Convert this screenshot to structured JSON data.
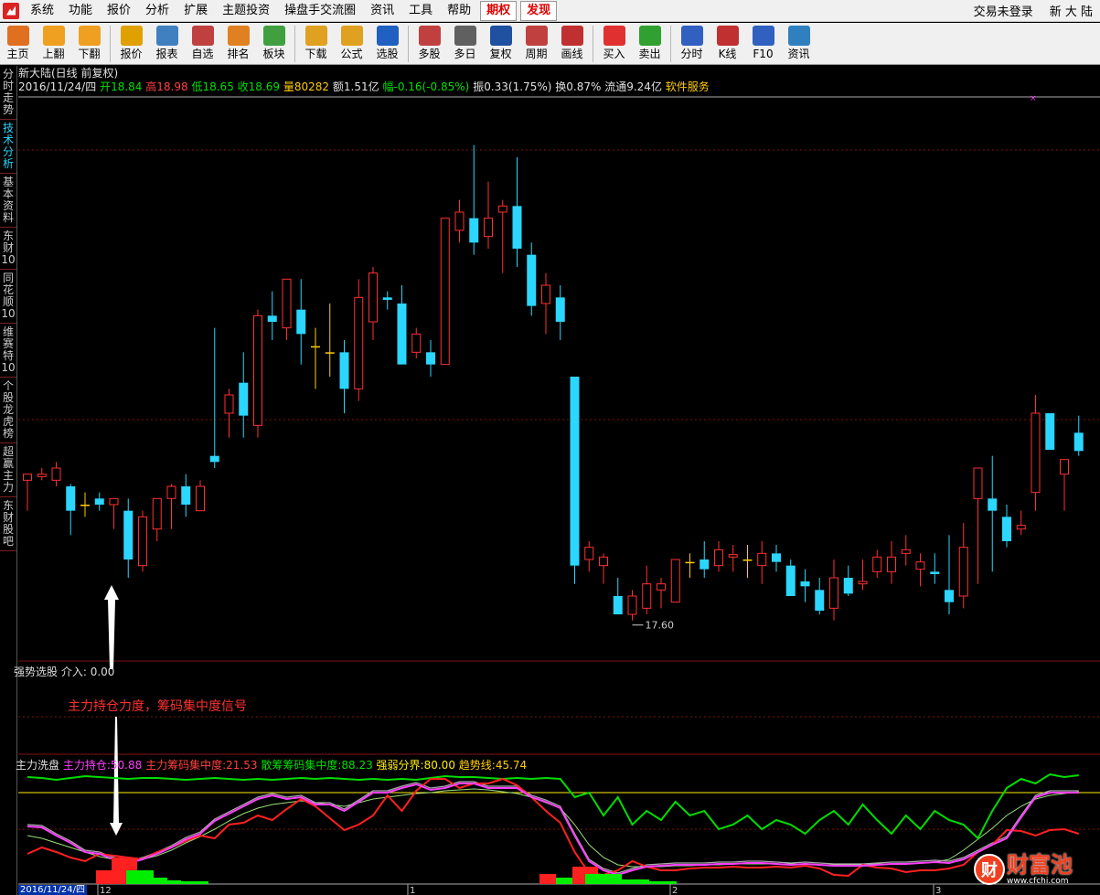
{
  "menu": {
    "items": [
      "系统",
      "功能",
      "报价",
      "分析",
      "扩展",
      "主题投资",
      "操盘手交流圈",
      "资讯",
      "工具",
      "帮助"
    ],
    "highlight": [
      "期权",
      "发现"
    ],
    "login_status": "交易未登录",
    "stock_name": "新 大 陆"
  },
  "toolbar": [
    {
      "icon": "home-icon",
      "label": "主页",
      "color": "#e07020"
    },
    {
      "icon": "up-arrow-icon",
      "label": "上翻",
      "color": "#f0a020"
    },
    {
      "icon": "down-arrow-icon",
      "label": "下翻",
      "color": "#f0a020"
    },
    {
      "icon": "yen-icon",
      "label": "报价",
      "color": "#e0a000"
    },
    {
      "icon": "table-icon",
      "label": "报表",
      "color": "#4080c0"
    },
    {
      "icon": "f6-icon",
      "label": "自选",
      "color": "#c04040"
    },
    {
      "icon": "ranking-icon",
      "label": "排名",
      "color": "#e08020"
    },
    {
      "icon": "blocks-icon",
      "label": "板块",
      "color": "#40a040"
    },
    {
      "icon": "download-icon",
      "label": "下载",
      "color": "#e0a020"
    },
    {
      "icon": "formula-icon",
      "label": "公式",
      "color": "#e0a020"
    },
    {
      "icon": "stock-select-icon",
      "label": "选股",
      "color": "#2060c0"
    },
    {
      "icon": "multi-stock-icon",
      "label": "多股",
      "color": "#c04040"
    },
    {
      "icon": "multi-day-icon",
      "label": "多日",
      "color": "#606060"
    },
    {
      "icon": "restore-right-icon",
      "label": "复权",
      "color": "#2050a0"
    },
    {
      "icon": "f8-icon",
      "label": "周期",
      "color": "#c04040"
    },
    {
      "icon": "draw-line-icon",
      "label": "画线",
      "color": "#c03030"
    },
    {
      "icon": "buy-icon",
      "label": "买入",
      "color": "#e03030"
    },
    {
      "icon": "sell-icon",
      "label": "卖出",
      "color": "#30a030"
    },
    {
      "icon": "intraday-icon",
      "label": "分时",
      "color": "#3060c0"
    },
    {
      "icon": "kline-icon",
      "label": "K线",
      "color": "#c03030"
    },
    {
      "icon": "f10-icon",
      "label": "F10",
      "color": "#3060c0"
    },
    {
      "icon": "news-icon",
      "label": "资讯",
      "color": "#3080c0"
    }
  ],
  "sidebar": [
    "分时走势",
    "技术分析",
    "基本资料",
    "东财10",
    "同花顺10",
    "维赛特10",
    "个股龙虎榜",
    "超赢主力",
    "东财股吧"
  ],
  "sidebar_active": 1,
  "header": {
    "title": "新大陆(日线 前复权)",
    "date": "2016/11/24/四",
    "open_label": "开",
    "open": "18.84",
    "high_label": "高",
    "high": "18.98",
    "low_label": "低",
    "low": "18.65",
    "close_label": "收",
    "close": "18.69",
    "volume_label": "量",
    "volume": "80282",
    "amount_label": "额",
    "amount": "1.51亿",
    "change_label": "幅",
    "change": "-0.16(-0.85%)",
    "amplitude_label": "振",
    "amplitude": "0.33(1.75%)",
    "turnover_label": "换",
    "turnover": "0.87%",
    "float_label": "流通",
    "float": "9.24亿",
    "software_service": "软件服务"
  },
  "price_low_label": "17.60",
  "panel2": {
    "title": "强势选股",
    "value_label": "介入:",
    "value": "0.00"
  },
  "annotation": "主力持仓力度，筹码集中度信号",
  "panel3": {
    "title": "主力洗盘",
    "items": [
      {
        "label": "主力持仓:",
        "value": "50.88",
        "color": "#ff40ff"
      },
      {
        "label": "主力筹码集中度:",
        "value": "21.53",
        "color": "#ff3030"
      },
      {
        "label": "散筹筹码集中度:",
        "value": "88.23",
        "color": "#00dd00"
      },
      {
        "label": "强弱分界:",
        "value": "80.00",
        "color": "#ffee00"
      },
      {
        "label": "趋势线:",
        "value": "45.74",
        "color": "#ffcc00"
      }
    ]
  },
  "axis": {
    "date_box": "2016/11/24/四",
    "ticks": [
      "12",
      "1",
      "2",
      "3"
    ]
  },
  "watermark": {
    "brand": "财富池",
    "url": "www.cfchi.com",
    "glyph": "财"
  },
  "colors": {
    "up": "#ff3030",
    "down": "#2bd6ff",
    "doji": "#ffcc00",
    "grid": "#801010"
  },
  "chart_data": {
    "type": "candlestick",
    "candles": [
      [
        18.45,
        18.5,
        18.2,
        18.5
      ],
      [
        18.48,
        18.55,
        18.45,
        18.5
      ],
      [
        18.45,
        18.6,
        18.4,
        18.55
      ],
      [
        18.4,
        18.42,
        18.0,
        18.2
      ],
      [
        18.25,
        18.35,
        18.15,
        18.25
      ],
      [
        18.3,
        18.35,
        18.2,
        18.25
      ],
      [
        18.25,
        18.3,
        18.05,
        18.3
      ],
      [
        18.2,
        18.3,
        17.65,
        17.8
      ],
      [
        17.75,
        18.2,
        17.7,
        18.15
      ],
      [
        18.05,
        18.3,
        17.95,
        18.3
      ],
      [
        18.3,
        18.42,
        18.05,
        18.4
      ],
      [
        18.4,
        18.5,
        18.15,
        18.25
      ],
      [
        18.2,
        18.45,
        18.2,
        18.4
      ],
      [
        18.65,
        19.7,
        18.55,
        18.6
      ],
      [
        19.0,
        19.2,
        18.8,
        19.15
      ],
      [
        19.25,
        19.5,
        18.8,
        18.98
      ],
      [
        18.9,
        19.85,
        18.8,
        19.8
      ],
      [
        19.8,
        20.0,
        19.6,
        19.75
      ],
      [
        19.7,
        20.1,
        19.6,
        20.1
      ],
      [
        19.85,
        20.1,
        19.4,
        19.65
      ],
      [
        19.55,
        19.7,
        19.2,
        19.55
      ],
      [
        19.5,
        19.9,
        19.3,
        19.5
      ],
      [
        19.5,
        19.6,
        19.0,
        19.2
      ],
      [
        19.2,
        20.1,
        19.1,
        19.95
      ],
      [
        19.75,
        20.2,
        19.6,
        20.15
      ],
      [
        19.95,
        20.0,
        19.85,
        19.93
      ],
      [
        19.9,
        20.05,
        19.4,
        19.4
      ],
      [
        19.5,
        19.7,
        19.45,
        19.65
      ],
      [
        19.5,
        19.6,
        19.3,
        19.4
      ],
      [
        19.4,
        20.6,
        19.4,
        20.6
      ],
      [
        20.5,
        20.75,
        20.4,
        20.65
      ],
      [
        20.6,
        21.2,
        20.3,
        20.4
      ],
      [
        20.45,
        20.9,
        20.35,
        20.6
      ],
      [
        20.65,
        20.75,
        20.15,
        20.7
      ],
      [
        20.7,
        21.1,
        20.2,
        20.35
      ],
      [
        20.3,
        20.4,
        19.8,
        19.88
      ],
      [
        19.9,
        20.15,
        19.65,
        20.05
      ],
      [
        19.95,
        20.05,
        19.6,
        19.75
      ],
      [
        19.3,
        19.3,
        17.6,
        17.75
      ],
      [
        17.8,
        17.95,
        17.7,
        17.9
      ],
      [
        17.75,
        17.85,
        17.6,
        17.82
      ],
      [
        17.5,
        17.65,
        17.35,
        17.35
      ],
      [
        17.35,
        17.55,
        17.3,
        17.5
      ],
      [
        17.4,
        17.75,
        17.35,
        17.6
      ],
      [
        17.55,
        17.65,
        17.4,
        17.6
      ],
      [
        17.45,
        17.8,
        17.45,
        17.8
      ],
      [
        17.78,
        17.85,
        17.65,
        17.78
      ],
      [
        17.8,
        17.95,
        17.65,
        17.72
      ],
      [
        17.75,
        17.95,
        17.7,
        17.88
      ],
      [
        17.82,
        17.92,
        17.7,
        17.84
      ],
      [
        17.8,
        17.92,
        17.65,
        17.8
      ],
      [
        17.75,
        17.95,
        17.6,
        17.85
      ],
      [
        17.85,
        17.92,
        17.7,
        17.78
      ],
      [
        17.75,
        17.8,
        17.5,
        17.5
      ],
      [
        17.62,
        17.72,
        17.45,
        17.58
      ],
      [
        17.55,
        17.65,
        17.35,
        17.38
      ],
      [
        17.4,
        17.8,
        17.3,
        17.65
      ],
      [
        17.65,
        17.75,
        17.5,
        17.52
      ],
      [
        17.6,
        17.8,
        17.55,
        17.62
      ],
      [
        17.7,
        17.88,
        17.65,
        17.82
      ],
      [
        17.7,
        17.95,
        17.6,
        17.82
      ],
      [
        17.85,
        18.0,
        17.75,
        17.88
      ],
      [
        17.72,
        17.85,
        17.58,
        17.78
      ],
      [
        17.7,
        17.85,
        17.6,
        17.68
      ],
      [
        17.55,
        18.0,
        17.35,
        17.45
      ],
      [
        17.5,
        18.1,
        17.4,
        17.9
      ],
      [
        18.3,
        18.5,
        17.6,
        18.55
      ],
      [
        18.3,
        18.65,
        17.7,
        18.2
      ],
      [
        18.15,
        18.25,
        17.9,
        17.95
      ],
      [
        18.05,
        18.2,
        18.0,
        18.08
      ],
      [
        18.35,
        19.15,
        18.2,
        19.0
      ],
      [
        19.0,
        18.55,
        18.8,
        18.7
      ],
      [
        18.5,
        18.6,
        18.2,
        18.62
      ],
      [
        18.84,
        18.98,
        18.65,
        18.69
      ]
    ]
  }
}
